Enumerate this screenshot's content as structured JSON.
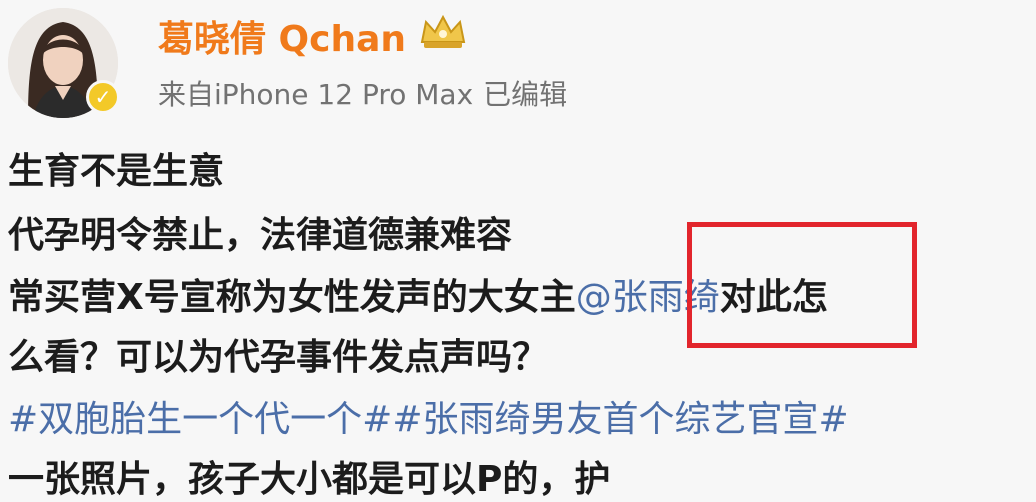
{
  "post": {
    "username": "葛晓倩 Qchan",
    "source": "来自iPhone 12 Pro Max",
    "edited": "已编辑",
    "lines": {
      "l1": "生育不是生意",
      "l2": "代孕明令禁止，法律道德兼难容",
      "l3_prefix": "常买营X号宣称为女性发声的大女主",
      "l3_mention": "@张雨绮",
      "l3_suffix": "对此怎",
      "l4": "么看？可以为代孕事件发点声吗？",
      "l5_tag1": "#双胞胎生一个代一个#",
      "l5_tag2": "#张雨绮男友首个综艺官宣#",
      "l6": "一张照片，孩子大小都是可以P的，护"
    }
  },
  "colors": {
    "username": "#f07a1b",
    "link": "#4b6ea8",
    "highlight": "#e2252c"
  },
  "icons": {
    "avatar": "user-avatar",
    "verified": "verified-badge-icon",
    "crown": "crown-badge-icon"
  }
}
